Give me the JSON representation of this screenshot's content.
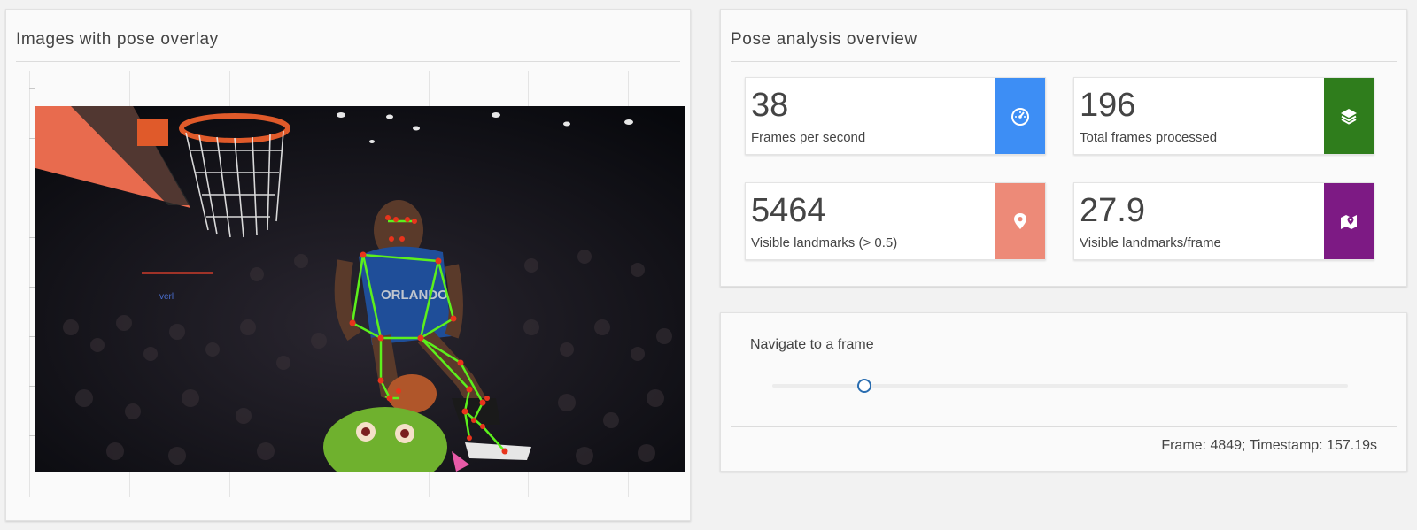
{
  "left_card": {
    "title": "Images with pose overlay"
  },
  "overview": {
    "title": "Pose analysis overview",
    "stats": [
      {
        "value": "38",
        "label": "Frames per second",
        "color": "#3d8ef5",
        "icon": "speedometer-icon"
      },
      {
        "value": "196",
        "label": "Total frames processed",
        "color": "#2f7d1c",
        "icon": "layers-icon"
      },
      {
        "value": "5464",
        "label": "Visible landmarks (> 0.5)",
        "color": "#ed8a78",
        "icon": "map-pin-icon"
      },
      {
        "value": "27.9",
        "label": "Visible landmarks/frame",
        "color": "#7d1a84",
        "icon": "map-marker-icon"
      }
    ]
  },
  "navigator": {
    "label": "Navigate to a frame",
    "slider_position": 0.16,
    "status": "Frame: 4849; Timestamp: 157.19s"
  },
  "image_text": {
    "jersey": "ORLANDO"
  }
}
